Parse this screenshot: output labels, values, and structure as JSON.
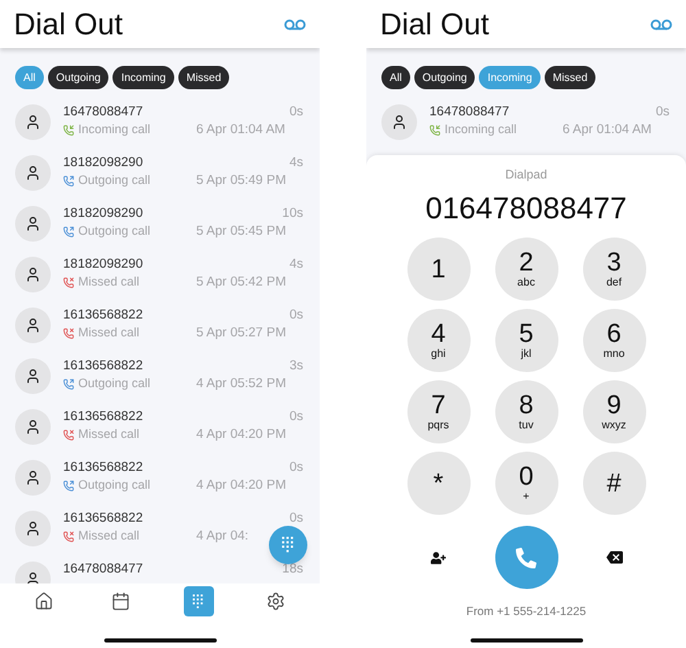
{
  "screens": [
    {
      "title": "Dial Out",
      "filters": [
        {
          "label": "All",
          "selected": true
        },
        {
          "label": "Outgoing",
          "selected": false
        },
        {
          "label": "Incoming",
          "selected": false
        },
        {
          "label": "Missed",
          "selected": false
        }
      ],
      "calls": [
        {
          "number": "16478088477",
          "kind": "incoming",
          "type_label": "Incoming call",
          "duration": "0s",
          "time": "6 Apr 01:04 AM"
        },
        {
          "number": "18182098290",
          "kind": "outgoing",
          "type_label": "Outgoing call",
          "duration": "4s",
          "time": "5 Apr 05:49 PM"
        },
        {
          "number": "18182098290",
          "kind": "outgoing",
          "type_label": "Outgoing call",
          "duration": "10s",
          "time": "5 Apr 05:45 PM"
        },
        {
          "number": "18182098290",
          "kind": "missed",
          "type_label": "Missed call",
          "duration": "4s",
          "time": "5 Apr 05:42 PM"
        },
        {
          "number": "16136568822",
          "kind": "missed",
          "type_label": "Missed call",
          "duration": "0s",
          "time": "5 Apr 05:27 PM"
        },
        {
          "number": "16136568822",
          "kind": "outgoing",
          "type_label": "Outgoing call",
          "duration": "3s",
          "time": "4 Apr 05:52 PM"
        },
        {
          "number": "16136568822",
          "kind": "missed",
          "type_label": "Missed call",
          "duration": "0s",
          "time": "4 Apr 04:20 PM"
        },
        {
          "number": "16136568822",
          "kind": "outgoing",
          "type_label": "Outgoing call",
          "duration": "0s",
          "time": "4 Apr 04:20 PM"
        },
        {
          "number": "16136568822",
          "kind": "missed",
          "type_label": "Missed call",
          "duration": "0s",
          "time": "4 Apr 04:"
        },
        {
          "number": "16478088477",
          "duration": "18s"
        }
      ],
      "nav": [
        {
          "kind": "home",
          "selected": false
        },
        {
          "kind": "calendar",
          "selected": false
        },
        {
          "kind": "dialpad",
          "selected": true
        },
        {
          "kind": "settings",
          "selected": false
        }
      ]
    },
    {
      "title": "Dial Out",
      "filters": [
        {
          "label": "All",
          "selected": false
        },
        {
          "label": "Outgoing",
          "selected": false
        },
        {
          "label": "Incoming",
          "selected": true
        },
        {
          "label": "Missed",
          "selected": false
        }
      ],
      "calls": [
        {
          "number": "16478088477",
          "kind": "incoming",
          "type_label": "Incoming call",
          "duration": "0s",
          "time": "6 Apr 01:04 AM"
        }
      ],
      "dialpad": {
        "label": "Dialpad",
        "number": "016478088477",
        "keys": [
          {
            "digit": "1"
          },
          {
            "digit": "2",
            "letters": "abc"
          },
          {
            "digit": "3",
            "letters": "def"
          },
          {
            "digit": "4",
            "letters": "ghi"
          },
          {
            "digit": "5",
            "letters": "jkl"
          },
          {
            "digit": "6",
            "letters": "mno"
          },
          {
            "digit": "7",
            "letters": "pqrs"
          },
          {
            "digit": "8",
            "letters": "tuv"
          },
          {
            "digit": "9",
            "letters": "wxyz"
          },
          {
            "digit": "*"
          },
          {
            "digit": "0",
            "letters": "+"
          },
          {
            "digit": "#"
          }
        ],
        "from": "From +1 555-214-1225"
      }
    }
  ]
}
